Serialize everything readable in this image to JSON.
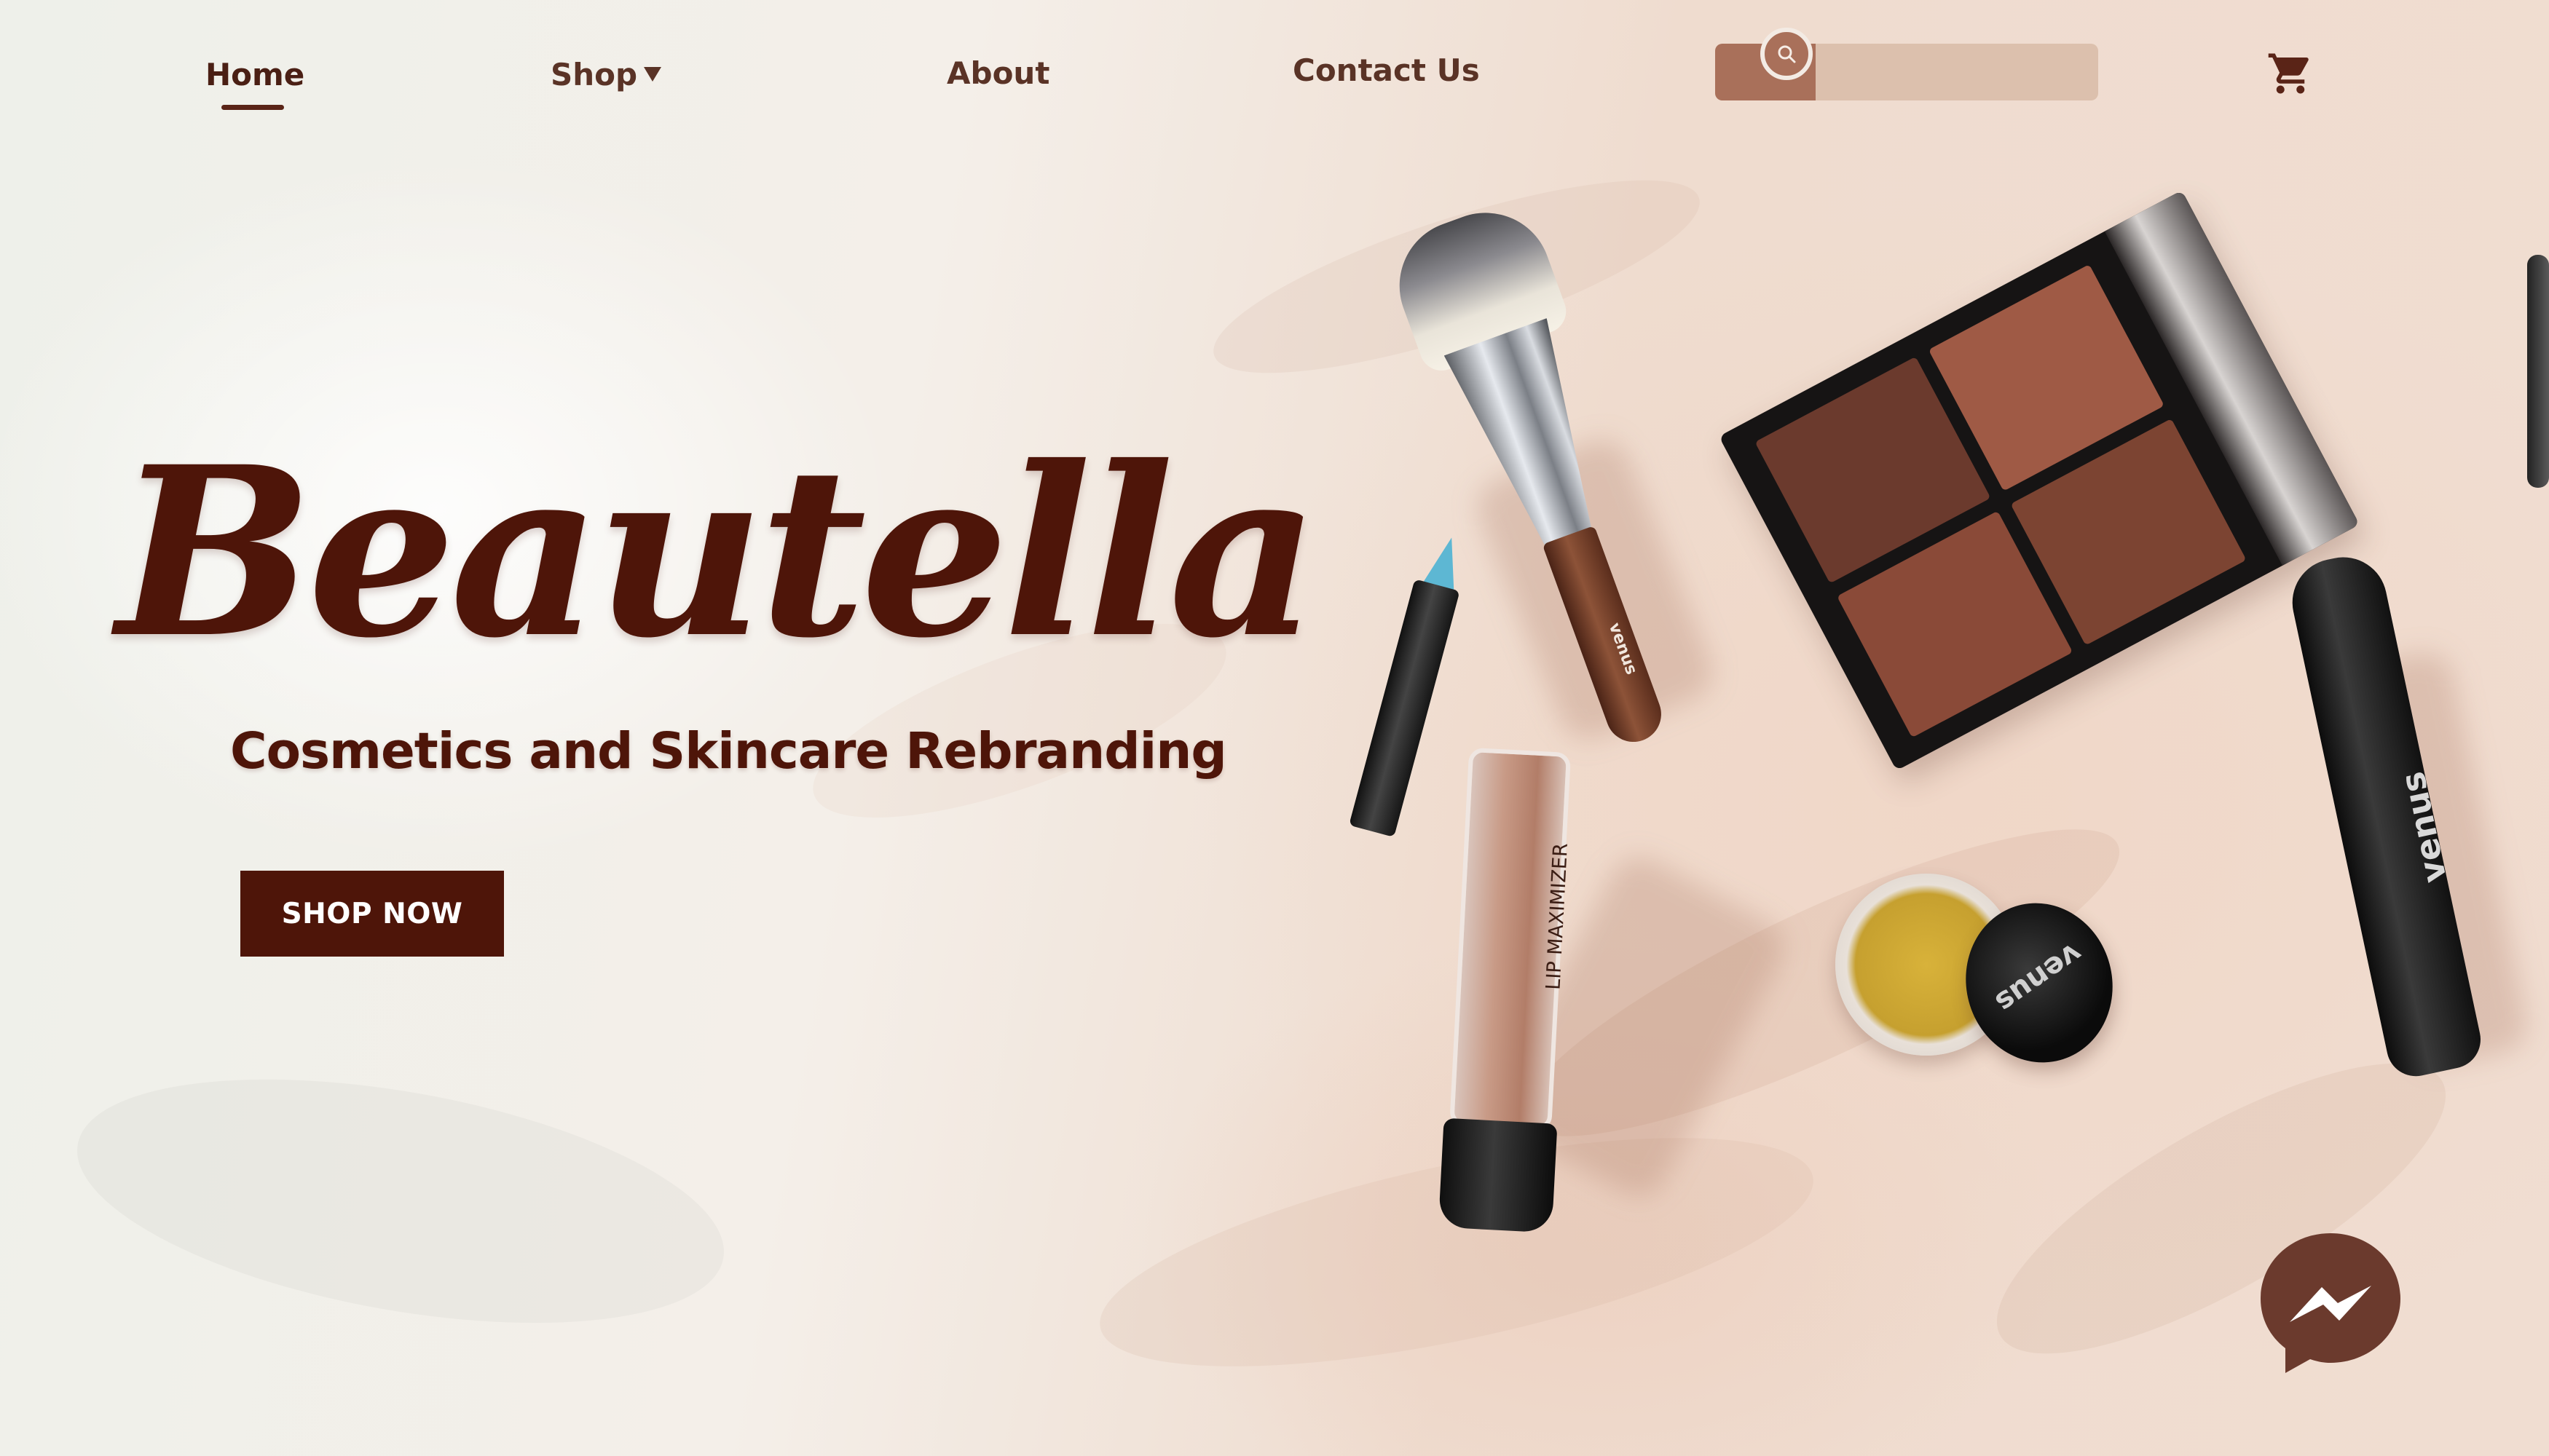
{
  "nav": {
    "items": [
      {
        "label": "Home",
        "active": true
      },
      {
        "label": "Shop",
        "has_dropdown": true
      },
      {
        "label": "About"
      },
      {
        "label": "Contact Us"
      }
    ]
  },
  "search": {
    "placeholder": "",
    "value": "",
    "icon": "search-icon"
  },
  "cart": {
    "icon": "cart-icon"
  },
  "hero": {
    "brand": "Beautella",
    "tagline": "Cosmetics and Skincare Rebranding",
    "cta_label": "SHOP NOW"
  },
  "products": {
    "brush_label": "venus",
    "mascara_label": "venus",
    "lip_label": "LIP MAXIMIZER",
    "pigment_label": "venus"
  },
  "messenger": {
    "icon": "messenger-icon"
  },
  "colors": {
    "brand": "#4e1509",
    "nav_text": "#5a3326",
    "search_bar": "#dcc0ad",
    "search_accent": "#a9705a",
    "messenger": "#6b3a2d"
  }
}
